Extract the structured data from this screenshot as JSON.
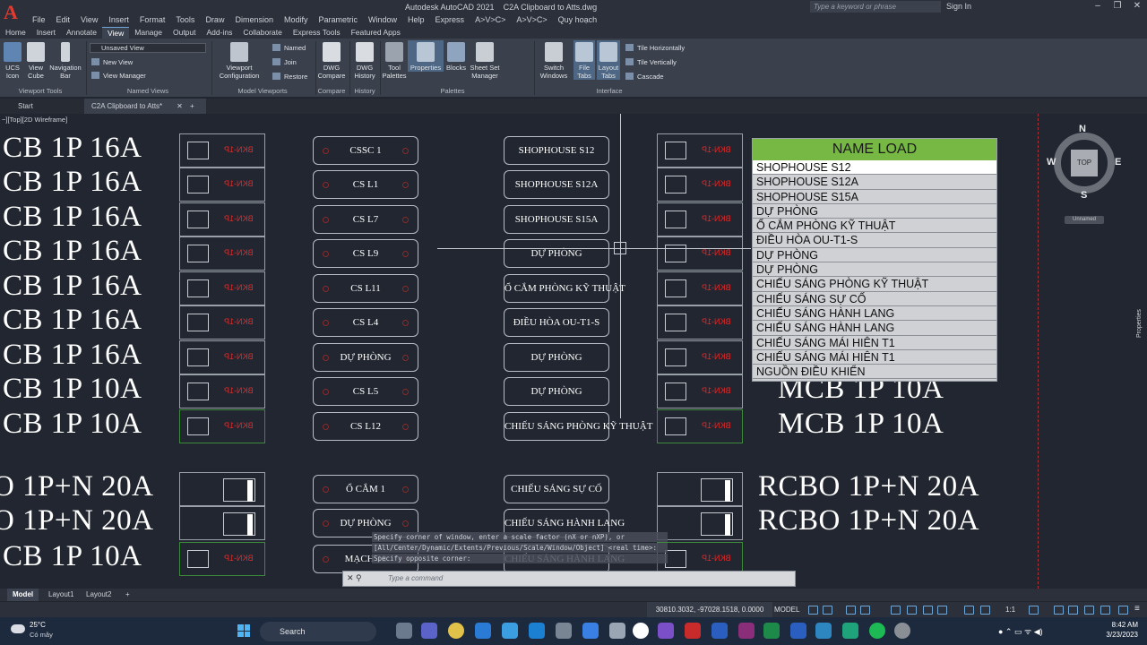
{
  "window": {
    "app_title": "Autodesk AutoCAD 2021",
    "file_title": "C2A Clipboard to Atts.dwg",
    "search_placeholder": "Type a keyword or phrase",
    "sign_in": "Sign In"
  },
  "menu": [
    "File",
    "Edit",
    "View",
    "Insert",
    "Format",
    "Tools",
    "Draw",
    "Dimension",
    "Modify",
    "Parametric",
    "Window",
    "Help",
    "Express",
    "A>V>C>",
    "A>V>C>",
    "Quy hoạch"
  ],
  "ribbon_tabs": [
    "Home",
    "Insert",
    "Annotate",
    "View",
    "Manage",
    "Output",
    "Add-ins",
    "Collaborate",
    "Express Tools",
    "Featured Apps"
  ],
  "ribbon_active_tab": "View",
  "ribbon": {
    "ucs_icon": "UCS Icon",
    "view_cube": "View Cube",
    "navigation_bar": "Navigation Bar",
    "viewport_tools": "Viewport Tools",
    "unsaved_view": "Unsaved View",
    "new_view": "New View",
    "view_manager": "View Manager",
    "named_views": "Named Views",
    "viewport_configuration": "Viewport Configuration",
    "named": "Named",
    "join": "Join",
    "restore": "Restore",
    "model_viewports": "Model Viewports",
    "dwg_compare": "DWG Compare",
    "compare": "Compare",
    "dwg_history": "DWG History",
    "history": "History",
    "tool_palettes": "Tool Palettes",
    "properties": "Properties",
    "blocks": "Blocks",
    "sheet_set_manager": "Sheet Set Manager",
    "palettes": "Palettes",
    "switch_windows": "Switch Windows",
    "file_tabs": "File Tabs",
    "layout_tabs": "Layout Tabs",
    "tile_horizontally": "Tile Horizontally",
    "tile_vertically": "Tile Vertically",
    "cascade": "Cascade",
    "interface": "Interface"
  },
  "file_tabs": {
    "start": "Start",
    "active_file": "C2A Clipboard to Atts*"
  },
  "drawing": {
    "view_label": "−][Top][2D Wireframe]",
    "left_labels": [
      "CB 1P 16A",
      "CB 1P 16A",
      "CB 1P 16A",
      "CB 1P 16A",
      "CB 1P 16A",
      "CB 1P 16A",
      "CB 1P 16A",
      "CB 1P 10A",
      "CB 1P 10A",
      "O 1P+N 20A",
      "O 1P+N 20A",
      "CB 1P 10A"
    ],
    "right_labels": [
      "MCB 1P 10A",
      "MCB 1P 10A",
      "RCBO 1P+N 20A",
      "RCBO 1P+N 20A"
    ],
    "breaker_label": "BKN-1P",
    "rcbo_label": "RCBO 1P+N",
    "col_a": [
      "CSSC 1",
      "CS L1",
      "CS L7",
      "CS L9",
      "CS L11",
      "CS L4",
      "DỰ PHÒNG",
      "CS L5",
      "CS L12",
      "Ổ CẮM 1",
      "DỰ PHÒNG",
      "MẠCH 18"
    ],
    "col_b": [
      "SHOPHOUSE S12",
      "SHOPHOUSE S12A",
      "SHOPHOUSE S15A",
      "DỰ PHÒNG",
      "Ổ CẮM PHÒNG KỸ THUẬT",
      "ĐIỀU HÒA OU-T1-S",
      "DỰ PHÒNG",
      "DỰ PHÒNG",
      "CHIẾU SÁNG PHÒNG KỸ THUẬT",
      "CHIẾU SÁNG SỰ CỐ",
      "CHIẾU SÁNG HÀNH LANG",
      "CHIẾU SÁNG HÀNH LANG"
    ]
  },
  "name_load": {
    "header": "NAME LOAD",
    "header_color": "#76b843",
    "rows": [
      "SHOPHOUSE S12",
      "SHOPHOUSE S12A",
      "SHOPHOUSE S15A",
      "DỰ PHÒNG",
      "Ổ CẮM PHÒNG KỸ THUẬT",
      "ĐIỀU HÒA OU-T1-S",
      "DỰ PHÒNG",
      "DỰ PHÒNG",
      "CHIẾU SÁNG PHÒNG KỸ THUẬT",
      "CHIẾU SÁNG SỰ CỐ",
      "CHIẾU SÁNG HÀNH LANG",
      "CHIẾU SÁNG HÀNH LANG",
      "CHIẾU SÁNG MÁI HIÊN T1",
      "CHIẾU SÁNG MÁI HIÊN T1",
      "NGUỒN ĐIỀU KHIỂN"
    ]
  },
  "viewcube": {
    "n": "N",
    "s": "S",
    "e": "E",
    "w": "W",
    "top": "TOP",
    "unnamed": "Unnamed"
  },
  "properties_side": "Properties",
  "command": {
    "history": [
      "Specify corner of window, enter a scale factor (nX or nXP), or",
      "[All/Center/Dynamic/Extents/Previous/Scale/Window/Object] <real time>:",
      "Specify opposite corner:"
    ],
    "placeholder": "Type a command"
  },
  "layout_tabs": [
    "Model",
    "Layout1",
    "Layout2"
  ],
  "status": {
    "coords": "30810.3032, -97028.1518, 0.0000",
    "model": "MODEL",
    "scale": "1:1"
  },
  "taskbar": {
    "temp": "25°C",
    "weather": "Có mây",
    "search": "Search",
    "time": "8:42 AM",
    "date": "3/23/2023"
  }
}
